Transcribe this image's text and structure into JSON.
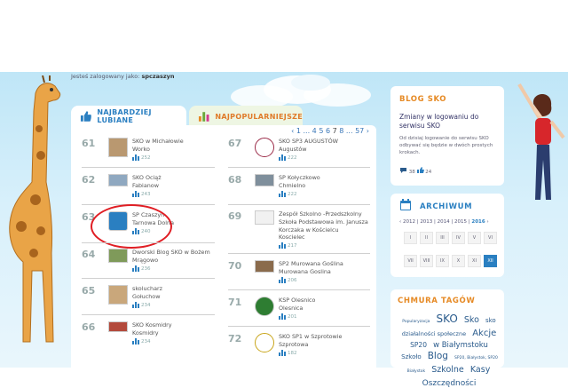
{
  "header": {
    "logged_prefix": "Jesteś zalogowany jako:",
    "username": "spczaszyn"
  },
  "tabs": [
    {
      "label": "NAJBARDZIEJ LUBIANE"
    },
    {
      "label": "NAJPOPULARNIEJSZE"
    }
  ],
  "pager": {
    "prev": "‹",
    "first": "1",
    "ellipsis": "...",
    "pages": [
      "4",
      "5",
      "6",
      "7",
      "8"
    ],
    "current": "7",
    "last": "57",
    "next": "›"
  },
  "left_items": [
    {
      "rank": "61",
      "name": "SKO w Michałowie",
      "sub": "Worko",
      "votes": "252"
    },
    {
      "rank": "62",
      "name": "SKO Ociąż",
      "sub": "Fabianow",
      "votes": "243"
    },
    {
      "rank": "63",
      "name": "SP Czaszyn",
      "sub": "Tarnowa Dolna",
      "votes": "240"
    },
    {
      "rank": "64",
      "name": "Dworski Blog SKO w Bożem Mrągowo",
      "sub": "",
      "votes": "236"
    },
    {
      "rank": "65",
      "name": "skolucharz",
      "sub": "Gołuchow",
      "votes": "234"
    },
    {
      "rank": "66",
      "name": "SKO Kosmidry",
      "sub": "Kosmidry",
      "votes": "234"
    }
  ],
  "right_items": [
    {
      "rank": "67",
      "name": "SKO SP3 AUGUSTÓW",
      "sub": "Augustów",
      "votes": "222"
    },
    {
      "rank": "68",
      "name": "SP Kołyczkowo",
      "sub": "Chmielno",
      "votes": "222"
    },
    {
      "rank": "69",
      "name": "Zespół Szkolno -Przedszkolny Szkoła Podstawowa im. Janusza Korczaka w Kościelcu",
      "sub": "Koscielec",
      "votes": "217"
    },
    {
      "rank": "70",
      "name": "SP2 Murowana Goślina",
      "sub": "Murowana Goslina",
      "votes": "206"
    },
    {
      "rank": "71",
      "name": "KSP Olesnico",
      "sub": "Olesnica",
      "votes": "201"
    },
    {
      "rank": "72",
      "name": "SKO SP1 w Szprotowie",
      "sub": "Szprotowa",
      "votes": "182"
    }
  ],
  "blog": {
    "header": "BLOG SKO",
    "post_title": "Zmiany w logowaniu do serwisu SKO",
    "post_body": "Od dzisiaj logowanie do serwisu SKO odbywać się będzie w dwóch prostych krokach.",
    "comments": "38",
    "likes": "24"
  },
  "archive": {
    "header": "ARCHIWUM",
    "prev": "‹",
    "next": "›",
    "years": [
      "2012",
      "2013",
      "2014",
      "2015",
      "2016"
    ],
    "active_year": "2016",
    "months": [
      "I",
      "II",
      "III",
      "IV",
      "V",
      "VI",
      "VII",
      "VIII",
      "IX",
      "X",
      "XI",
      "XII"
    ],
    "active_month": "XII"
  },
  "tags": {
    "header": "CHMURA TAGÓW",
    "items": [
      {
        "t": "Popularyzacja",
        "s": 4.5
      },
      {
        "t": "SKO",
        "s": 12
      },
      {
        "t": "Sko",
        "s": 9.5
      },
      {
        "t": "sko",
        "s": 7
      },
      {
        "t": "działalności społeczne",
        "s": 6.5
      },
      {
        "t": "Akcje",
        "s": 10
      },
      {
        "t": "SP20",
        "s": 7.5
      },
      {
        "t": "w Białymstoku",
        "s": 8.5
      },
      {
        "t": "Szkoło",
        "s": 7
      },
      {
        "t": "Blog",
        "s": 10.5
      },
      {
        "t": "SP20, Białystok, SP20 Białystok",
        "s": 4.5
      },
      {
        "t": "Szkolne",
        "s": 9.5
      },
      {
        "t": "Kasy",
        "s": 9.5
      },
      {
        "t": "Oszczędności",
        "s": 9
      }
    ]
  },
  "colors": {
    "accent_blue": "#2a7fc1",
    "accent_orange": "#e68a25",
    "highlight_circle": "#e01e24"
  }
}
